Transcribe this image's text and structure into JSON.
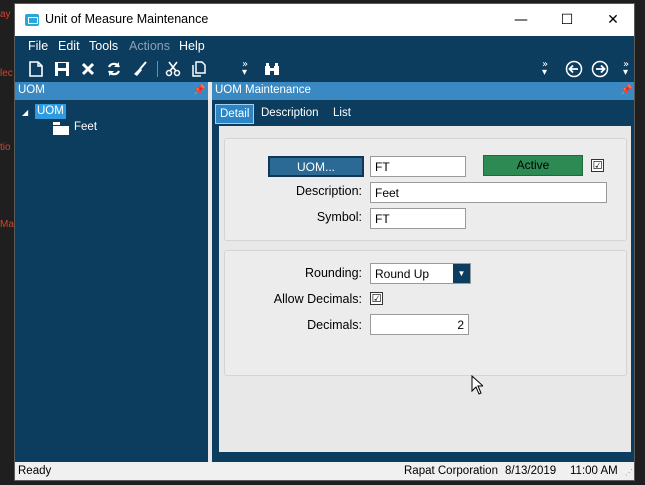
{
  "window": {
    "title": "Unit of Measure Maintenance",
    "minimize_glyph": "—",
    "maximize_glyph": "☐",
    "close_glyph": "✕"
  },
  "background": {
    "fragments": [
      "ay",
      "lec",
      "tio",
      "Ma"
    ]
  },
  "menu": {
    "items": [
      "File",
      "Edit",
      "Tools",
      "Actions",
      "Help"
    ]
  },
  "toolbar": {
    "icons": [
      "new-icon",
      "save-icon",
      "delete-icon",
      "refresh-icon",
      "clear-icon",
      "cut-icon",
      "copy-icon",
      "overflow-chevron-icon",
      "find-binoculars-icon",
      "overflow-chevron-icon",
      "back-arrow-icon",
      "forward-arrow-icon",
      "overflow-chevron-icon"
    ]
  },
  "left_panel": {
    "header": "UOM",
    "tree_root": "UOM",
    "tree_child": "Feet"
  },
  "right_panel": {
    "header": "UOM Maintenance",
    "tabs": [
      "Detail",
      "Description",
      "List"
    ],
    "active_tab": "Detail"
  },
  "form": {
    "uom_button": "UOM...",
    "uom_value": "FT",
    "active_label": "Active",
    "active_checked": "☑",
    "description_label": "Description:",
    "description_value": "Feet",
    "symbol_label": "Symbol:",
    "symbol_value": "FT",
    "rounding_label": "Rounding:",
    "rounding_value": "Round Up",
    "allow_decimals_label": "Allow Decimals:",
    "allow_decimals_checked": "☑",
    "decimals_label": "Decimals:",
    "decimals_value": "2"
  },
  "status": {
    "left": "Ready",
    "company": "Rapat Corporation",
    "date": "8/13/2019",
    "time": "11:00 AM"
  },
  "colors": {
    "navy": "#0d3d5e",
    "header_blue": "#3a89c3",
    "active_green": "#2c8a52"
  }
}
